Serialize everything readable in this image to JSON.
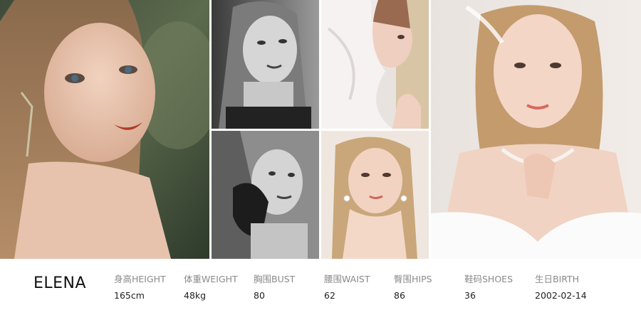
{
  "model": {
    "name": "ELENA"
  },
  "stats": [
    {
      "label": "身高HEIGHT",
      "value": "165cm"
    },
    {
      "label": "体重WEIGHT",
      "value": "48kg"
    },
    {
      "label": "胸围BUST",
      "value": "80"
    },
    {
      "label": "腰围WAIST",
      "value": "62"
    },
    {
      "label": "臀围HIPS",
      "value": "86"
    },
    {
      "label": "鞋码SHOES",
      "value": "36"
    },
    {
      "label": "生日BIRTH",
      "value": "2002-02-14"
    }
  ],
  "colors": {
    "label": "#8a8a8a",
    "value": "#222222",
    "name": "#111111"
  }
}
